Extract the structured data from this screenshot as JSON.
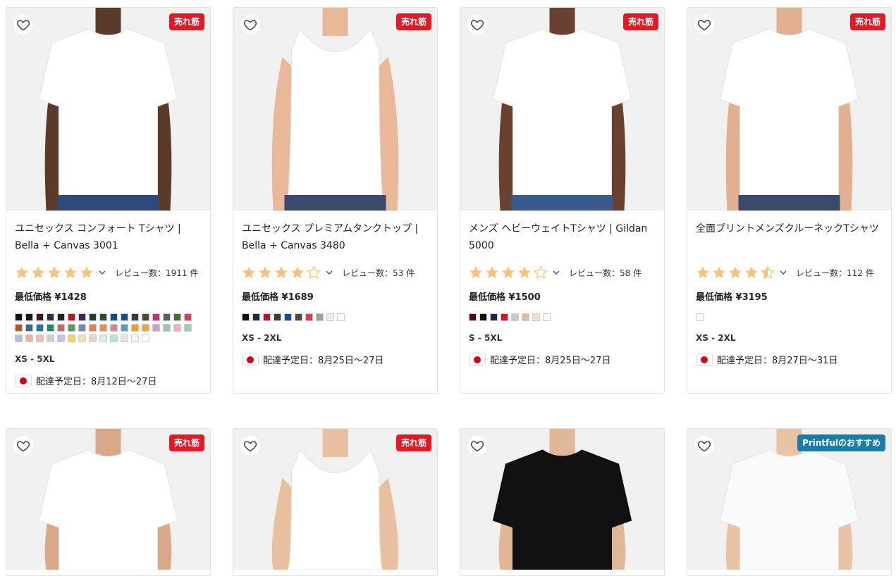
{
  "products": [
    {
      "title": "ユニセックス コンフォート Tシャツ | Bella + Canvas 3001",
      "badge": "売れ筋",
      "stars": 5,
      "reviews": "レビュー数：1911 件",
      "price": "最低価格 ¥1428",
      "sizes": "XS - 5XL",
      "delivery": "配達予定日：8月12日〜27日",
      "image_colors": {
        "bg": "#f0f0f0",
        "skin": "#5a3a28",
        "shirt": "#ffffff",
        "pants": "#2d4a7a"
      },
      "swatches": [
        "#111111",
        "#151515",
        "#3a1a20",
        "#2a2f45",
        "#222222",
        "#b0182a",
        "#3b2b50",
        "#243a2a",
        "#2e4a30",
        "#0e4f8a",
        "#1a4a9a",
        "#3b3b3b",
        "#4a4a30",
        "#c03070",
        "#606060",
        "#4d6a2a",
        "#d04060",
        "#c0541a",
        "#3a6b8a",
        "#1a7a9a",
        "#1a8a6a",
        "#c06a6a",
        "#5a9a4a",
        "#6a8ab0",
        "#f07a50",
        "#f08a50",
        "#d08a90",
        "#5a9ac0",
        "#f0a020",
        "#f0a830",
        "#d0a0c0",
        "#a0c0b0",
        "#f0b0c0",
        "#a0d0b0",
        "#b0c0e0",
        "#f0b0a0",
        "#f0b8b8",
        "#d0d0d0",
        "#b8c8d8",
        "#f0d060",
        "#f0e0c0",
        "#e8d8c8",
        "#d0f0e8",
        "#b0e8d0",
        "#e8e8e0",
        "#f8f8f0",
        "#ffffff"
      ]
    },
    {
      "title": "ユニセックス プレミアムタンクトップ | Bella + Canvas 3480",
      "badge": "売れ筋",
      "stars": 4,
      "reviews": "レビュー数：53 件",
      "price": "最低価格 ¥1689",
      "sizes": "XS - 2XL",
      "delivery": "配達予定日：8月25日〜27日",
      "image_colors": {
        "bg": "#f0f0f0",
        "skin": "#e8b898",
        "shirt": "#ffffff",
        "pants": "#3a4a6a"
      },
      "swatches": [
        "#111111",
        "#1a2a40",
        "#b0182a",
        "#3a3a3a",
        "#1a4a9a",
        "#4a4a4a",
        "#d04050",
        "#a0a0a0",
        "#f0ece4",
        "#ffffff"
      ]
    },
    {
      "title": "メンズ ヘビーウェイトTシャツ | Gildan 5000",
      "badge": "売れ筋",
      "stars": 4,
      "reviews": "レビュー数：58 件",
      "price": "最低価格 ¥1500",
      "sizes": "S - 5XL",
      "delivery": "配達予定日：8月25日〜27日",
      "image_colors": {
        "bg": "#f0f0f0",
        "skin": "#6a4030",
        "shirt": "#ffffff",
        "pants": "#3a5a8a"
      },
      "swatches": [
        "#4a0a1a",
        "#111111",
        "#1a2a40",
        "#d0182a",
        "#c8c8c8",
        "#d8c0a8",
        "#f0e0d0",
        "#ffffff"
      ]
    },
    {
      "title": "全面プリントメンズクルーネックTシャツ",
      "badge": "売れ筋",
      "stars": 4.5,
      "reviews": "レビュー数：112 件",
      "price": "最低価格 ¥3195",
      "sizes": "XS - 2XL",
      "delivery": "配達予定日：8月27日〜31日",
      "image_colors": {
        "bg": "#f0f0f0",
        "skin": "#e0b090",
        "shirt": "#ffffff",
        "pants": "#3a4a6a"
      },
      "swatches": [
        "#ffffff"
      ]
    },
    {
      "badge": "売れ筋",
      "image_colors": {
        "bg": "#f0f0f0",
        "skin": "#d8a888",
        "shirt": "#ffffff",
        "pants": "#3a4a6a"
      }
    },
    {
      "badge": "売れ筋",
      "image_colors": {
        "bg": "#f0f0f0",
        "skin": "#e8c0a0",
        "shirt": "#ffffff",
        "pants": "#3a4a6a"
      }
    },
    {
      "badge": "",
      "image_colors": {
        "bg": "#f0f0f0",
        "skin": "#e0b898",
        "shirt": "#111111",
        "pants": "#3a4a6a"
      }
    },
    {
      "badge": "Printfulのおすすめ",
      "image_colors": {
        "bg": "#f0f0f0",
        "skin": "#e8c4a4",
        "shirt": "#fafafa",
        "pants": "#3a4a6a"
      }
    }
  ],
  "colors": {
    "badge_red": "#e31923",
    "badge_blue": "#1a7da6",
    "star_fill": "#f4c27a",
    "star_empty": "#f4c27a"
  }
}
